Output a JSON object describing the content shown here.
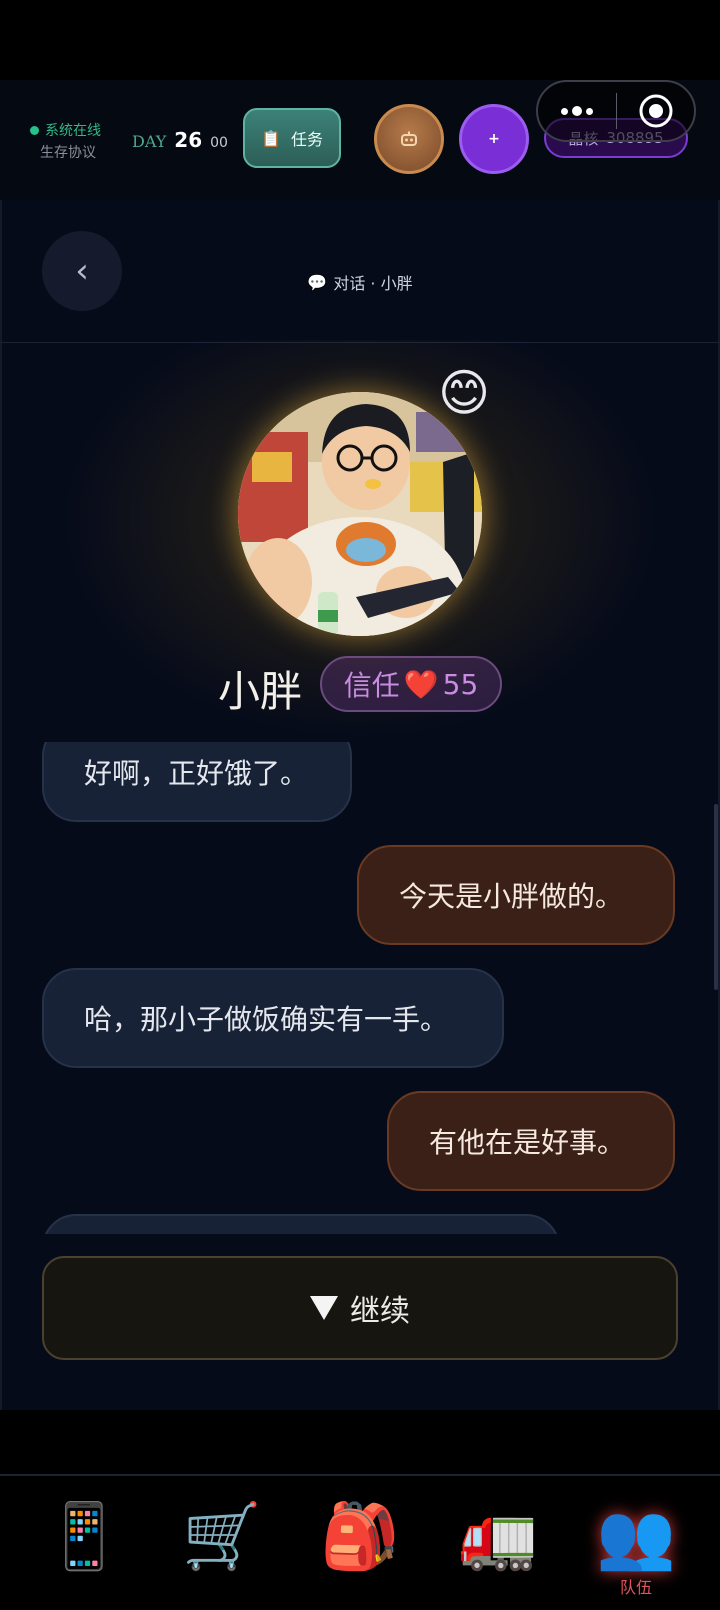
{
  "header": {
    "status_text": "系统在线",
    "protocol_text": "生存协议",
    "day_label": "DAY",
    "day_number": "26",
    "day_sub": "00",
    "task_label": "任务",
    "crystal_label": "晶核",
    "crystal_value": "308895",
    "plus_label": "+"
  },
  "chat": {
    "title": "对话 · 小胖",
    "character_name": "小胖",
    "trust_label": "信任",
    "trust_value": "55",
    "mood_emoji": "😊",
    "messages": [
      {
        "from": "npc",
        "text": "好啊，正好饿了。"
      },
      {
        "from": "me",
        "text": "今天是小胖做的。"
      },
      {
        "from": "npc",
        "text": "哈，那小子做饭确实有一手。"
      },
      {
        "from": "me",
        "text": "有他在是好事。"
      }
    ],
    "continue_label": "继续"
  },
  "nav": {
    "items": [
      {
        "icon": "📱",
        "name": "phone-icon",
        "label": ""
      },
      {
        "icon": "🛒",
        "name": "cart-icon",
        "label": ""
      },
      {
        "icon": "🎒",
        "name": "backpack-icon",
        "label": ""
      },
      {
        "icon": "🚛",
        "name": "truck-icon",
        "label": ""
      },
      {
        "icon": "👥",
        "name": "team-icon",
        "label": "队伍"
      }
    ],
    "active_index": 4
  },
  "colors": {
    "accent_green": "#27c28a",
    "npc_bubble": "#182236",
    "player_bubble": "#3a2016",
    "trust_text": "#c98ce0",
    "nav_active": "#e2545a"
  }
}
